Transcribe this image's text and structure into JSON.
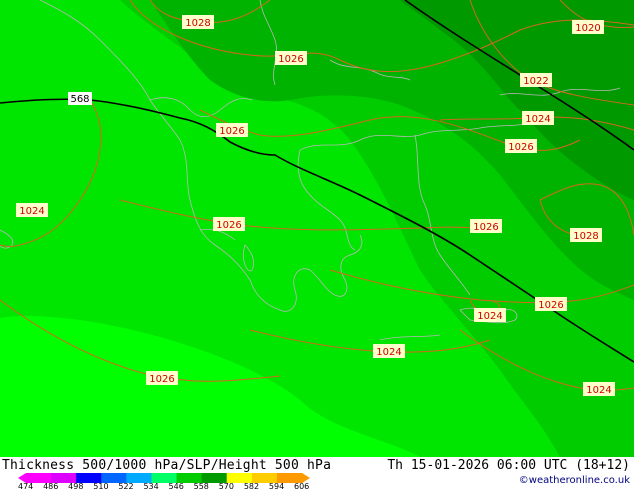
{
  "map": {
    "pressure_labels": [
      "1028",
      "1026",
      "1020",
      "1022",
      "1026",
      "1024",
      "1026",
      "1024",
      "1026",
      "1026",
      "1028",
      "1026",
      "1024",
      "1024",
      "1026",
      "1024"
    ],
    "thickness_label": "568",
    "colors": {
      "thickness_line": "#000000",
      "isobar": "#d2691e",
      "coast": "#b0b0b0",
      "label_bg": "#ffffcc",
      "label_text": "#cc0000"
    },
    "fill_colors": [
      "#00ff00",
      "#00e600",
      "#00cc00",
      "#00b300",
      "#009900"
    ]
  },
  "footer": {
    "title": "Thickness 500/1000 hPa/SLP/Height 500 hPa",
    "datetime": "Th 15-01-2026 06:00 UTC (18+12)",
    "copyright": "©weatheronline.co.uk"
  },
  "scale": {
    "ticks": [
      "474",
      "486",
      "498",
      "510",
      "522",
      "534",
      "546",
      "558",
      "570",
      "582",
      "594",
      "606"
    ],
    "colors": [
      "#ff00ff",
      "#dd00ff",
      "#0000ff",
      "#0066ff",
      "#00aaff",
      "#00ff66",
      "#00cc00",
      "#009900",
      "#ffff00",
      "#ffcc00",
      "#ff9900"
    ]
  }
}
